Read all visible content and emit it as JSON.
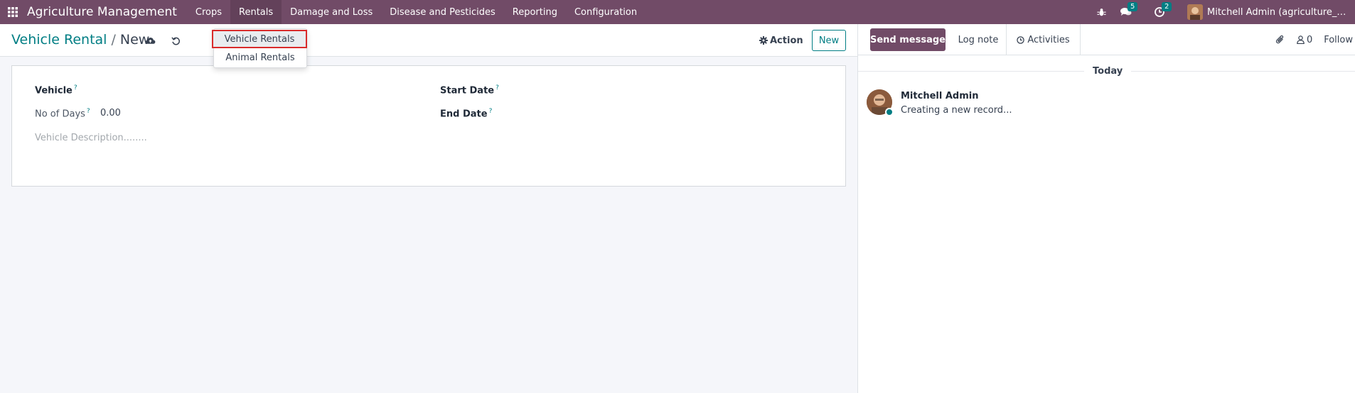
{
  "navbar": {
    "app_title": "Agriculture Management",
    "menu": [
      "Crops",
      "Rentals",
      "Damage and Loss",
      "Disease and Pesticides",
      "Reporting",
      "Configuration"
    ],
    "messages_count": "5",
    "activities_count": "2",
    "user_name": "Mitchell Admin (agriculture_managem..."
  },
  "dropdown": {
    "items": [
      "Vehicle Rentals",
      "Animal Rentals"
    ]
  },
  "control_panel": {
    "breadcrumb_parent": "Vehicle Rental",
    "breadcrumb_separator": "/",
    "breadcrumb_current": "New",
    "action_label": "Action",
    "new_label": "New"
  },
  "form": {
    "vehicle_label": "Vehicle",
    "start_date_label": "Start Date",
    "no_of_days_label": "No of Days",
    "no_of_days_value": "0.00",
    "end_date_label": "End Date",
    "description_placeholder": "Vehicle Description........",
    "help_marker": "?"
  },
  "chatter": {
    "send_message_label": "Send message",
    "log_note_label": "Log note",
    "activities_label": "Activities",
    "followers_count": "0",
    "follow_label": "Follow",
    "date_separator": "Today",
    "message_author": "Mitchell Admin",
    "message_body": "Creating a new record..."
  },
  "colors": {
    "brand": "#714b67",
    "accent": "#017e84",
    "highlight": "#d92b2b"
  }
}
